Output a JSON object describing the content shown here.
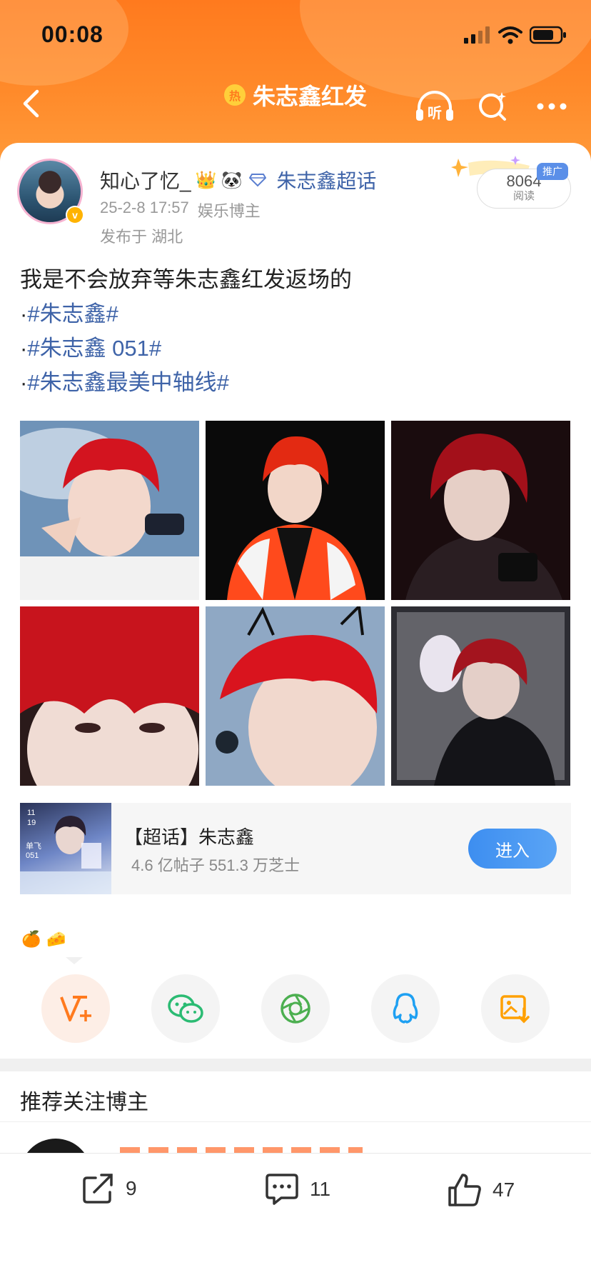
{
  "status_bar": {
    "time": "00:08"
  },
  "nav": {
    "title": "朱志鑫红发",
    "hot_badge": "热",
    "listen_label": "听"
  },
  "post": {
    "author": "知心了忆_",
    "author_badges": [
      "👑",
      "🐼"
    ],
    "supertopic_link": "朱志鑫超话",
    "date": "25-2-8 17:57",
    "author_tag": "娱乐博主",
    "location": "发布于 湖北",
    "reads": {
      "count": "8064",
      "label": "阅读",
      "promo": "推广"
    },
    "text_lines": [
      {
        "prefix": "",
        "text": "我是不会放弃等朱志鑫红发返场的",
        "is_tag": false
      },
      {
        "prefix": "·",
        "text": "#朱志鑫#",
        "is_tag": true
      },
      {
        "prefix": "·",
        "text": "#朱志鑫 051#",
        "is_tag": true
      },
      {
        "prefix": "·",
        "text": "#朱志鑫最美中轴线#",
        "is_tag": true
      }
    ]
  },
  "supertopic_card": {
    "name": "【超话】朱志鑫",
    "stats": "4.6 亿帖子  551.3 万芝士",
    "enter_label": "进入",
    "thumb_texts": [
      "11",
      "19",
      "单飞",
      "051"
    ]
  },
  "reactions": [
    "🍊",
    "🧀"
  ],
  "share_options": [
    "weibo-share",
    "wechat",
    "moments",
    "qq",
    "save-image"
  ],
  "recommend": {
    "title": "推荐关注博主"
  },
  "bottom_bar": {
    "share_count": "9",
    "comment_count": "11",
    "like_count": "47"
  },
  "colors": {
    "accent_orange": "#ff7a1e",
    "link_blue": "#3e63a8",
    "button_blue": "#3d8ef0"
  }
}
